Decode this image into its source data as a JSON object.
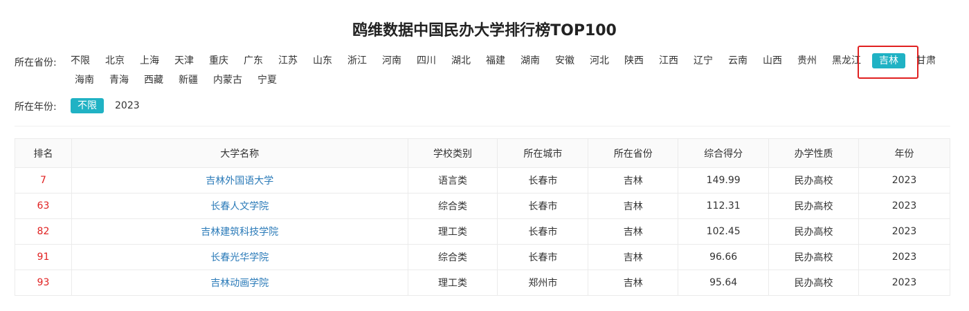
{
  "page": {
    "title": "鸥维数据中国民办大学排行榜TOP100"
  },
  "filters": {
    "province": {
      "label": "所在省份:",
      "items": [
        "不限",
        "北京",
        "上海",
        "天津",
        "重庆",
        "广东",
        "江苏",
        "山东",
        "浙江",
        "河南",
        "四川",
        "湖北",
        "福建",
        "湖南",
        "安徽",
        "河北",
        "陕西",
        "江西",
        "辽宁",
        "云南",
        "山西",
        "贵州",
        "黑龙江",
        "吉林",
        "甘肃",
        "海南",
        "青海",
        "西藏",
        "新疆",
        "内蒙古",
        "宁夏"
      ],
      "selected": "吉林"
    },
    "year": {
      "label": "所在年份:",
      "items": [
        "不限",
        "2023"
      ],
      "selected": "不限"
    }
  },
  "table": {
    "headers": [
      "排名",
      "大学名称",
      "学校类别",
      "所在城市",
      "所在省份",
      "综合得分",
      "办学性质",
      "年份"
    ],
    "rows": [
      [
        "7",
        "吉林外国语大学",
        "语言类",
        "长春市",
        "吉林",
        "149.99",
        "民办高校",
        "2023"
      ],
      [
        "63",
        "长春人文学院",
        "综合类",
        "长春市",
        "吉林",
        "112.31",
        "民办高校",
        "2023"
      ],
      [
        "82",
        "吉林建筑科技学院",
        "理工类",
        "长春市",
        "吉林",
        "102.45",
        "民办高校",
        "2023"
      ],
      [
        "91",
        "长春光华学院",
        "综合类",
        "长春市",
        "吉林",
        "96.66",
        "民办高校",
        "2023"
      ],
      [
        "93",
        "吉林动画学院",
        "理工类",
        "郑州市",
        "吉林",
        "95.64",
        "民办高校",
        "2023"
      ]
    ]
  },
  "colors": {
    "accent": "#20b2c4",
    "rank": "#e02020",
    "link": "#2a7ab8",
    "highlight_box": "#e02020"
  }
}
